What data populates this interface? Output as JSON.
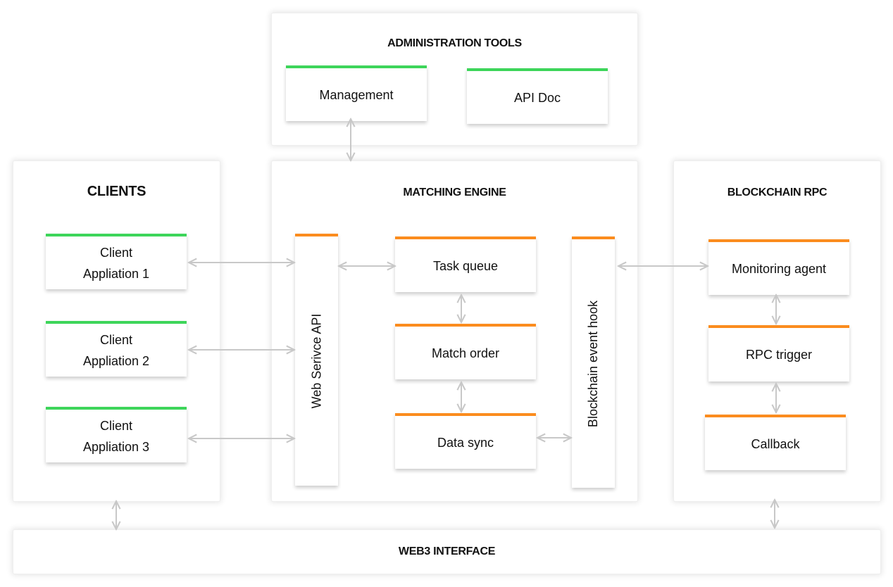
{
  "admin": {
    "title": "ADMINISTRATION TOOLS",
    "management": "Management",
    "api_doc": "API Doc"
  },
  "clients": {
    "title": "CLIENTS",
    "items": [
      {
        "line1": "Client",
        "line2": "Appliation 1"
      },
      {
        "line1": "Client",
        "line2": "Appliation 2"
      },
      {
        "line1": "Client",
        "line2": "Appliation 3"
      }
    ]
  },
  "matching": {
    "title": "MATCHING ENGINE",
    "web_api": "Web Serivce API",
    "task_queue": "Task queue",
    "match_order": "Match order",
    "data_sync": "Data sync",
    "event_hook": "Blockchain event hook"
  },
  "blockchain": {
    "title": "BLOCKCHAIN RPC",
    "monitoring": "Monitoring agent",
    "rpc_trigger": "RPC trigger",
    "callback": "Callback"
  },
  "web3": {
    "title": "WEB3 INTERFACE"
  },
  "colors": {
    "client_accent": "#3dd55a",
    "engine_accent": "#fb8c1e",
    "arrow": "#c8c8c8"
  }
}
